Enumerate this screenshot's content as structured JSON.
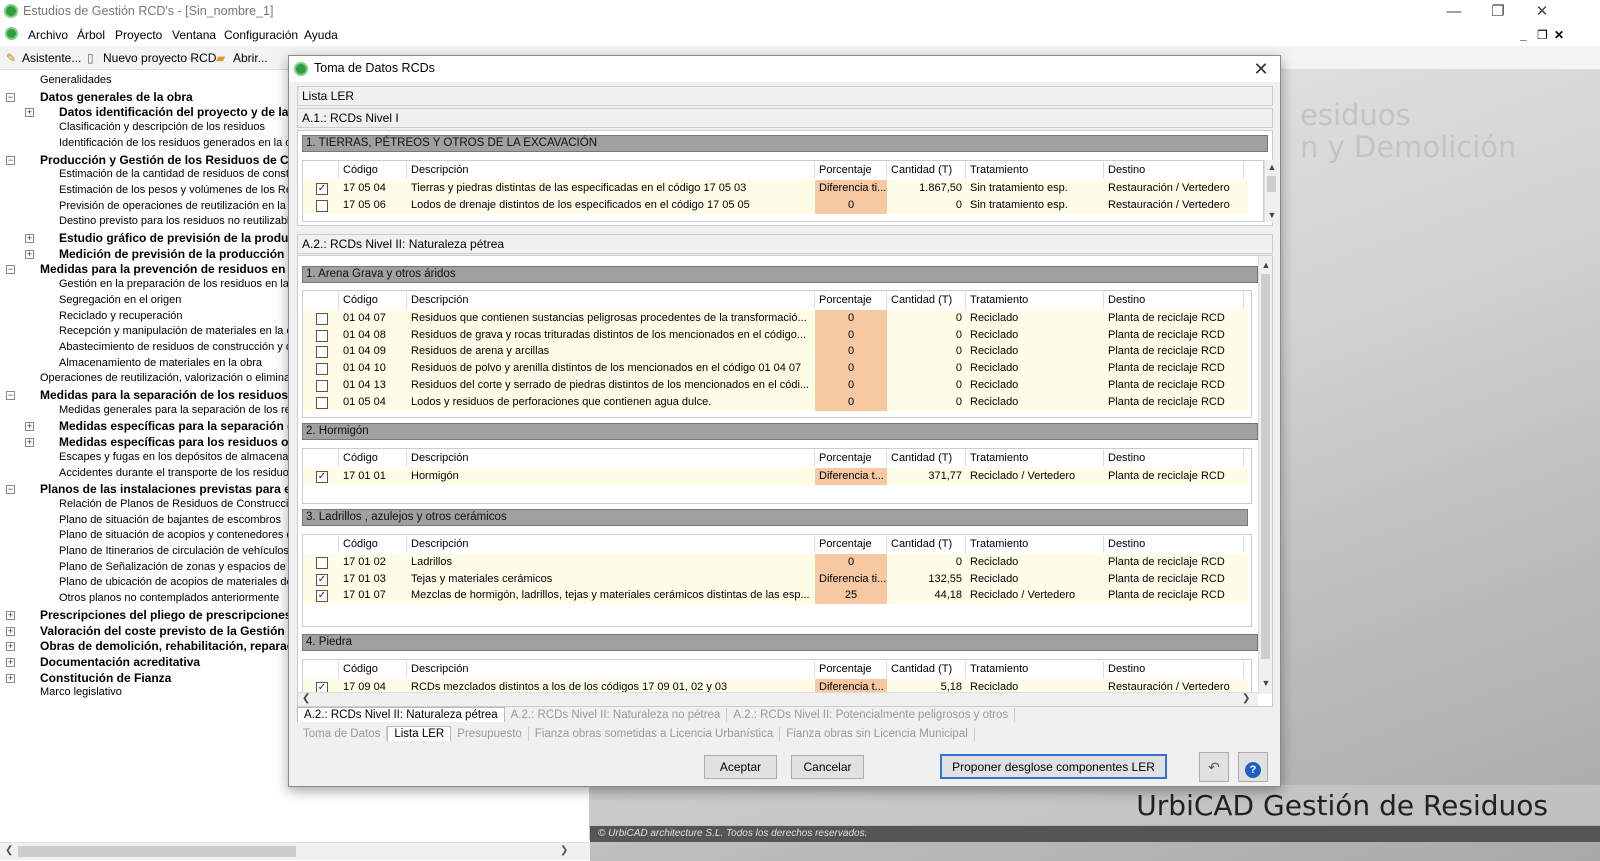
{
  "window": {
    "title": "Estudios de Gestión RCD's - [Sin_nombre_1]",
    "minimize": "—",
    "restore": "❐",
    "close": "✕"
  },
  "menu": [
    "Archivo",
    "Árbol",
    "Proyecto",
    "Ventana",
    "Configuración",
    "Ayuda"
  ],
  "mdi_controls": [
    "_",
    "❐",
    "✕"
  ],
  "toolbar": [
    "Asistente...",
    "Nuevo proyecto RCD",
    "Abrir..."
  ],
  "tree": [
    {
      "label": "Generalidades",
      "level": 1,
      "bold": false,
      "exp": ""
    },
    {
      "label": "Datos generales de la obra",
      "level": 1,
      "bold": true,
      "exp": "−"
    },
    {
      "label": "Datos identificación del proyecto y de la",
      "level": 2,
      "bold": true,
      "exp": "+"
    },
    {
      "label": "Clasificación y descripción de los residuos",
      "level": 2,
      "bold": false,
      "exp": ""
    },
    {
      "label": "Identificación de los residuos generados en la obr",
      "level": 2,
      "bold": false,
      "exp": ""
    },
    {
      "label": "Producción y Gestión de los Residuos de Co",
      "level": 1,
      "bold": true,
      "exp": "−"
    },
    {
      "label": "Estimación de la cantidad de residuos de construc",
      "level": 2,
      "bold": false,
      "exp": ""
    },
    {
      "label": "Estimación de los pesos y volúmenes de los Resid",
      "level": 2,
      "bold": false,
      "exp": ""
    },
    {
      "label": "Previsión de operaciones de reutilización en la mis",
      "level": 2,
      "bold": false,
      "exp": ""
    },
    {
      "label": "Destino previsto para los residuos no reutilizables",
      "level": 2,
      "bold": false,
      "exp": ""
    },
    {
      "label": "Estudio gráfico de previsión de la produc",
      "level": 2,
      "bold": true,
      "exp": "+"
    },
    {
      "label": "Medición de previsión de la producción d",
      "level": 2,
      "bold": true,
      "exp": "+"
    },
    {
      "label": "Medidas para la prevención de residuos en l",
      "level": 1,
      "bold": true,
      "exp": "−"
    },
    {
      "label": "Gestión en la preparación de los residuos en la ob",
      "level": 2,
      "bold": false,
      "exp": ""
    },
    {
      "label": "Segregación en el origen",
      "level": 2,
      "bold": false,
      "exp": ""
    },
    {
      "label": "Reciclado y recuperación",
      "level": 2,
      "bold": false,
      "exp": ""
    },
    {
      "label": "Recepción y manipulación de materiales en la obr",
      "level": 2,
      "bold": false,
      "exp": ""
    },
    {
      "label": "Abastecimiento de residuos de construcción y dem",
      "level": 2,
      "bold": false,
      "exp": ""
    },
    {
      "label": "Almacenamiento de materiales en la obra",
      "level": 2,
      "bold": false,
      "exp": ""
    },
    {
      "label": "Operaciones de reutilización, valorización o eliminació",
      "level": 1,
      "bold": false,
      "exp": ""
    },
    {
      "label": "Medidas para la separación de los residuos e",
      "level": 1,
      "bold": true,
      "exp": "−"
    },
    {
      "label": "Medidas generales para la separación de los resid",
      "level": 2,
      "bold": false,
      "exp": ""
    },
    {
      "label": "Medidas específicas para la separación c",
      "level": 2,
      "bold": true,
      "exp": "+"
    },
    {
      "label": "Medidas específicas para los residuos oc",
      "level": 2,
      "bold": true,
      "exp": "+"
    },
    {
      "label": "Escapes y fugas en los depósitos de almacenamie",
      "level": 2,
      "bold": false,
      "exp": ""
    },
    {
      "label": "Accidentes durante el transporte de los residuos a",
      "level": 2,
      "bold": false,
      "exp": ""
    },
    {
      "label": "Planos de las instalaciones previstas para el",
      "level": 1,
      "bold": true,
      "exp": "−"
    },
    {
      "label": "Relación de Planos de Residuos de Construcción",
      "level": 2,
      "bold": false,
      "exp": ""
    },
    {
      "label": "Plano de situación de bajantes de escombros",
      "level": 2,
      "bold": false,
      "exp": ""
    },
    {
      "label": "Plano de situación de acopios y contenedores de",
      "level": 2,
      "bold": false,
      "exp": ""
    },
    {
      "label": "Plano de Itinerarios de circulación de vehículos p",
      "level": 2,
      "bold": false,
      "exp": ""
    },
    {
      "label": "Plano de Señalización de zonas y espacios de RC",
      "level": 2,
      "bold": false,
      "exp": ""
    },
    {
      "label": "Plano de ubicación de acopios de materiales de r",
      "level": 2,
      "bold": false,
      "exp": ""
    },
    {
      "label": "Otros planos no contemplados anteriormente",
      "level": 2,
      "bold": false,
      "exp": ""
    },
    {
      "label": "Prescripciones del pliego de prescripciones t",
      "level": 1,
      "bold": true,
      "exp": "+"
    },
    {
      "label": "Valoración del coste previsto de la Gestión c",
      "level": 1,
      "bold": true,
      "exp": "+"
    },
    {
      "label": "Obras de demolición, rehabilitación, reparaci",
      "level": 1,
      "bold": true,
      "exp": "+"
    },
    {
      "label": "Documentación acreditativa",
      "level": 1,
      "bold": true,
      "exp": "+"
    },
    {
      "label": "Constitución de Fianza",
      "level": 1,
      "bold": true,
      "exp": "+"
    },
    {
      "label": "Marco legislativo",
      "level": 1,
      "bold": false,
      "exp": ""
    }
  ],
  "background": {
    "line1": "esiduos",
    "line2": "n y Demolición",
    "brand": "UrbiCAD Gestión de Residuos",
    "copyright": "© UrbiCAD architecture S.L. Todos los derechos reservados."
  },
  "dialog": {
    "title": "Toma de Datos RCDs",
    "close": "✕",
    "section_lista": "Lista LER",
    "section_a1": "A.1.: RCDs Nivel I",
    "section_a2": "A.2.: RCDs Nivel II: Naturaleza pétrea",
    "columns": [
      "Código",
      "Descripción",
      "Porcentaje",
      "Cantidad (T)",
      "Tratamiento",
      "Destino"
    ],
    "a1_group": "1. TIERRAS, PÉTREOS Y OTROS DE LA EXCAVACIÓN",
    "a1_rows": [
      {
        "checked": true,
        "code": "17 05 04",
        "desc": "Tierras y piedras distintas de las especificadas en el código 17 05 03",
        "pct": "Diferencia ti...",
        "qty": "1.867,50",
        "trat": "Sin tratamiento esp.",
        "dest": "Restauración / Vertedero"
      },
      {
        "checked": false,
        "code": "17 05 06",
        "desc": "Lodos de drenaje distintos de los especificados en el código 17 05 05",
        "pct": "0",
        "qty": "0",
        "trat": "Sin tratamiento esp.",
        "dest": "Restauración / Vertedero"
      }
    ],
    "groups": [
      {
        "title": "1. Arena Grava y otros áridos",
        "rows": [
          {
            "checked": false,
            "code": "01 04 07",
            "desc": "Residuos que contienen sustancias peligrosas procedentes de la transformació...",
            "pct": "0",
            "qty": "0",
            "trat": "Reciclado",
            "dest": "Planta de reciclaje RCD"
          },
          {
            "checked": false,
            "code": "01 04 08",
            "desc": "Residuos de grava y rocas trituradas distintos de los mencionados en el código...",
            "pct": "0",
            "qty": "0",
            "trat": "Reciclado",
            "dest": "Planta de reciclaje RCD"
          },
          {
            "checked": false,
            "code": "01 04 09",
            "desc": "Residuos de arena y arcillas",
            "pct": "0",
            "qty": "0",
            "trat": "Reciclado",
            "dest": "Planta de reciclaje RCD"
          },
          {
            "checked": false,
            "code": "01 04 10",
            "desc": "Residuos de polvo y arenilla distintos de los mencionados en el código 01 04 07",
            "pct": "0",
            "qty": "0",
            "trat": "Reciclado",
            "dest": "Planta de reciclaje RCD"
          },
          {
            "checked": false,
            "code": "01 04 13",
            "desc": "Residuos del corte y serrado de piedras distintos de los mencionados en el códi...",
            "pct": "0",
            "qty": "0",
            "trat": "Reciclado",
            "dest": "Planta de reciclaje RCD"
          },
          {
            "checked": false,
            "code": "01 05 04",
            "desc": "Lodos y residuos de perforaciones que contienen agua dulce.",
            "pct": "0",
            "qty": "0",
            "trat": "Reciclado",
            "dest": "Planta de reciclaje RCD"
          }
        ]
      },
      {
        "title": "2. Hormigón",
        "rows": [
          {
            "checked": true,
            "code": "17 01 01",
            "desc": "Hormigón",
            "pct": "Diferencia t...",
            "qty": "371,77",
            "trat": "Reciclado / Vertedero",
            "dest": "Planta de reciclaje RCD"
          }
        ]
      },
      {
        "title": "3. Ladrillos , azulejos y otros cerámicos",
        "rows": [
          {
            "checked": false,
            "code": "17 01 02",
            "desc": "Ladrillos",
            "pct": "0",
            "qty": "0",
            "trat": "Reciclado",
            "dest": "Planta de reciclaje RCD"
          },
          {
            "checked": true,
            "code": "17 01 03",
            "desc": "Tejas y materiales cerámicos",
            "pct": "Diferencia ti...",
            "qty": "132,55",
            "trat": "Reciclado",
            "dest": "Planta de reciclaje RCD"
          },
          {
            "checked": true,
            "code": "17 01 07",
            "desc": "Mezclas de hormigón, ladrillos, tejas y materiales cerámicos distintas de las esp...",
            "pct": "25",
            "qty": "44,18",
            "trat": "Reciclado / Vertedero",
            "dest": "Planta de reciclaje RCD"
          }
        ]
      },
      {
        "title": "4. Piedra",
        "rows": [
          {
            "checked": true,
            "code": "17 09 04",
            "desc": "RCDs mezclados distintos a los de los códigos 17 09 01, 02 y 03",
            "pct": "Diferencia t...",
            "qty": "5,18",
            "trat": "Reciclado",
            "dest": "Restauración / Vertedero"
          }
        ]
      }
    ],
    "inner_tabs": [
      "A.2.: RCDs Nivel II: Naturaleza pétrea",
      "A.2.: RCDs Nivel II: Naturaleza no pétrea",
      "A.2.: RCDs Nivel II: Potencialmente peligrosos y otros"
    ],
    "outer_tabs": [
      "Toma de Datos",
      "Lista LER",
      "Presupuesto",
      "Fianza obras sometidas a Licencia Urbanística",
      "Fianza obras sin Licencia Municipal"
    ],
    "buttons": {
      "accept": "Aceptar",
      "cancel": "Cancelar",
      "propose": "Proponer desglose componentes LER",
      "undo": "↶",
      "help": "?"
    }
  }
}
